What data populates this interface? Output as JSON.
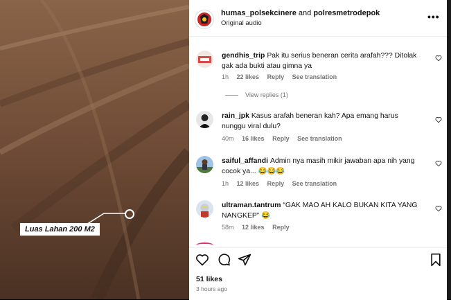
{
  "media": {
    "overlay_label": "Luas Lahan 200 M2"
  },
  "header": {
    "username": "humas_polsekcinere",
    "and_text": "and",
    "collab_username": "polresmetrodepok",
    "audio": "Original audio",
    "more_icon": "more-horizontal-icon"
  },
  "comments": [
    {
      "username": "gendhis_trip",
      "text": "Pak itu serius beneran cerita arafah??? Ditolak gak ada bukti atau gimna ya",
      "time": "1h",
      "likes": "22 likes",
      "reply": "Reply",
      "translation": "See translation"
    },
    {
      "username": "rain_jpk",
      "text": "Kasus arafah beneran kah? Apa emang harus nunggu viral dulu?",
      "time": "40m",
      "likes": "16 likes",
      "reply": "Reply",
      "translation": "See translation"
    },
    {
      "username": "saiful_affandi",
      "text": "Admin nya masih mikir jawaban apa nih yang cocok ya... 😂😂😂",
      "time": "1h",
      "likes": "12 likes",
      "reply": "Reply",
      "translation": "See translation"
    },
    {
      "username": "ultraman.tantrum",
      "text": "“GAK MAO AH KALO BUKAN KITA YANG NANGKEP” 😂",
      "time": "58m",
      "likes": "12 likes",
      "reply": "Reply"
    }
  ],
  "view_replies": "View replies (1)",
  "actions": {
    "likes": "51 likes",
    "posted": "3 hours ago"
  },
  "colors": {
    "accent": "#e1306c",
    "muted": "#737373"
  }
}
